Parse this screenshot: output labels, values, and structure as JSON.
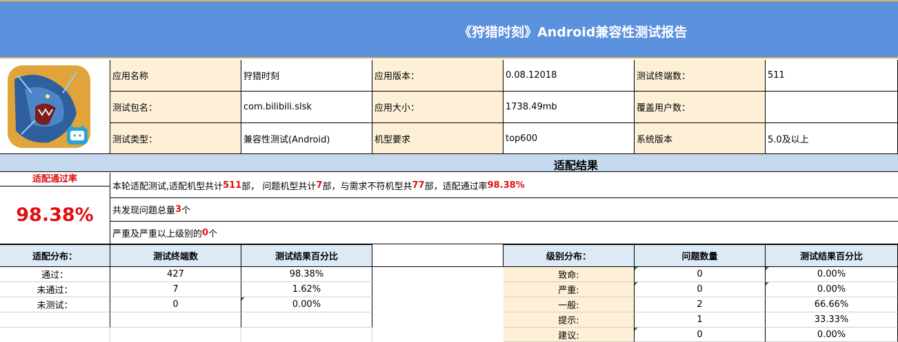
{
  "title": "《狩猎时刻》Android兼容性测试报告",
  "info": {
    "rows": [
      [
        {
          "label": "应用名称",
          "value": "狩猎时刻"
        },
        {
          "label": "应用版本：",
          "value": "0.08.12018"
        },
        {
          "label": "测试终端数：",
          "value": "511"
        }
      ],
      [
        {
          "label": "测试包名：",
          "value": "com.bilibili.slsk"
        },
        {
          "label": "应用大小：",
          "value": "1738.49mb"
        },
        {
          "label": "覆盖用户数：",
          "value": ""
        }
      ],
      [
        {
          "label": "测试类型：",
          "value": "兼容性测试(Android)"
        },
        {
          "label": "机型要求",
          "value": "top600"
        },
        {
          "label": "系统版本",
          "value": "5.0及以上"
        }
      ]
    ]
  },
  "section_title": "适配结果",
  "pass_rate_label": "适配通过率",
  "pass_rate": "98.38%",
  "summary": {
    "line1": {
      "p1": "本轮适配测试,适配机型共计",
      "total": "511",
      "p2": "部， 问题机型共计",
      "problem": "7",
      "p3": "部，与需求不符机型共",
      "mismatch": "77",
      "p4": "部，适配通过率",
      "rate": "98.38%"
    },
    "line2": {
      "p1": "共发现问题总量",
      "count": "3",
      "p2": "个"
    },
    "line3": {
      "p1": "严重及严重以上级别的",
      "count": "0",
      "p2": "个"
    }
  },
  "dist": {
    "headers": [
      "适配分布：",
      "测试终端数",
      "测试结果百分比"
    ],
    "rows": [
      {
        "label": "通过：",
        "count": "427",
        "pct": "98.38%"
      },
      {
        "label": "未通过：",
        "count": "7",
        "pct": "1.62%"
      },
      {
        "label": "未测试：",
        "count": "0",
        "pct": "0.00%"
      }
    ]
  },
  "levels": {
    "headers": [
      "级别分布：",
      "问题数量",
      "测试结果百分比"
    ],
    "rows": [
      {
        "label": "致命:",
        "count": "0",
        "pct": "0.00%"
      },
      {
        "label": "严重:",
        "count": "0",
        "pct": "0.00%"
      },
      {
        "label": "一般:",
        "count": "2",
        "pct": "66.66%"
      },
      {
        "label": "提示:",
        "count": "1",
        "pct": "33.33%"
      },
      {
        "label": "建议:",
        "count": "0",
        "pct": "0.00%"
      }
    ]
  }
}
